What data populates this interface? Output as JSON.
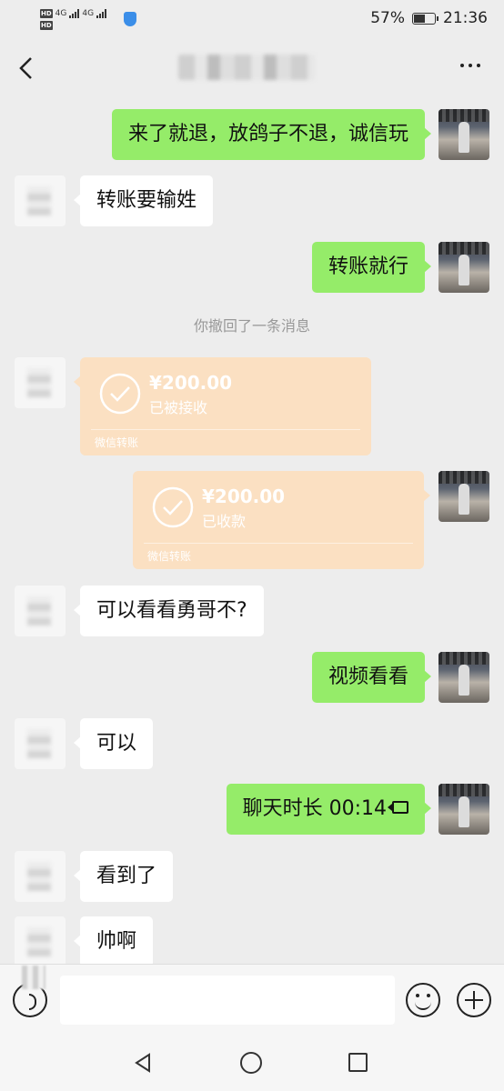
{
  "status_bar": {
    "hd1": "HD",
    "hd2": "HD",
    "signal1": "4G",
    "signal2": "4G",
    "battery_percent_visible": "57%",
    "time": "21:36"
  },
  "header": {
    "back_icon": "chevron-left-icon",
    "more_icon": "ellipsis-icon"
  },
  "messages": [
    {
      "from": "self",
      "text": "来了就退，放鸽子不退，诚信玩"
    },
    {
      "from": "other",
      "text": "转账要输姓"
    },
    {
      "from": "self",
      "text": "转账就行"
    },
    {
      "from": "system",
      "text": "你撤回了一条消息"
    },
    {
      "from": "other",
      "type": "transfer",
      "amount": "¥200.00",
      "status": "已被接收",
      "label": "微信转账"
    },
    {
      "from": "self",
      "type": "transfer",
      "amount": "¥200.00",
      "status": "已收款",
      "label": "微信转账"
    },
    {
      "from": "other",
      "text": "可以看看勇哥不?"
    },
    {
      "from": "self",
      "text": "视频看看"
    },
    {
      "from": "other",
      "text": "可以"
    },
    {
      "from": "self",
      "type": "video_call",
      "text": "聊天时长 00:14"
    },
    {
      "from": "other",
      "text": "看到了"
    },
    {
      "from": "other",
      "text": "帅啊"
    }
  ],
  "input_bar": {
    "value": "",
    "voice_icon": "voice-icon",
    "emoji_icon": "emoji-icon",
    "plus_icon": "plus-icon"
  },
  "system_nav": {
    "back_icon": "triangle-back-icon",
    "home_icon": "circle-home-icon",
    "recent_icon": "square-recent-icon"
  },
  "colors": {
    "background": "#ededed",
    "self_bubble": "#95ec69",
    "other_bubble": "#ffffff",
    "transfer_bubble": "#fbe0c2",
    "system_text": "#999999"
  }
}
